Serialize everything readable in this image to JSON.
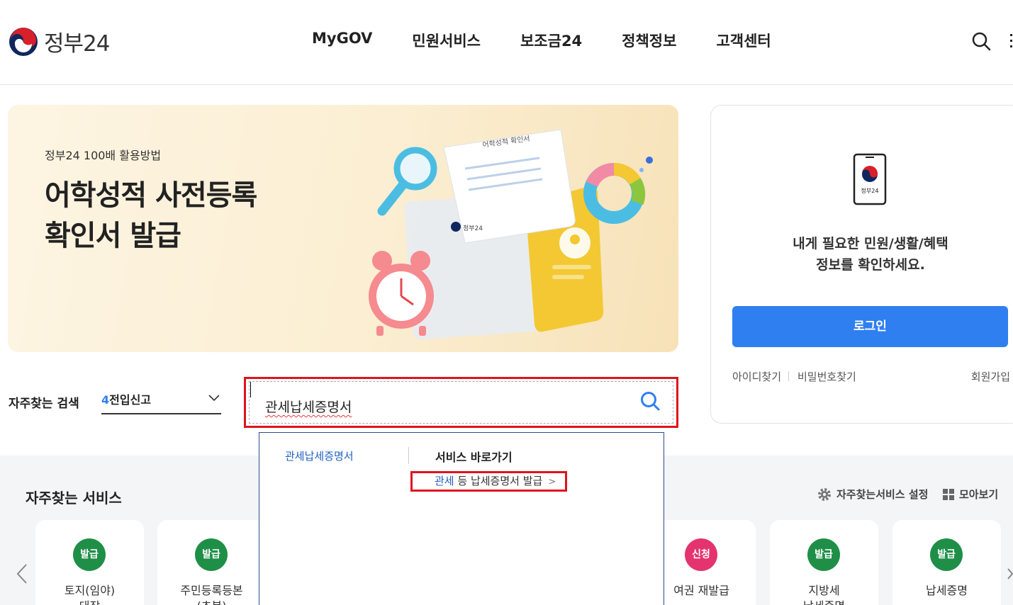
{
  "header": {
    "logo_text": "정부24",
    "nav": [
      "MyGOV",
      "민원서비스",
      "보조금24",
      "정책정보",
      "고객센터"
    ],
    "icons": [
      "search-icon",
      "menu-icon"
    ]
  },
  "banner": {
    "subtitle": "정부24 100배 활용방법",
    "title_line1": "어학성적 사전등록",
    "title_line2": "확인서 발급",
    "art_doc_title": "어학성적 확인서",
    "art_doc_brand": "정부24"
  },
  "login": {
    "phone_label": "정부24",
    "message_line1": "내게 필요한 민원/생활/혜택",
    "message_line2": "정보를 확인하세요.",
    "button": "로그인",
    "find_id": "아이디찾기",
    "find_pw": "비밀번호찾기",
    "signup": "회원가입"
  },
  "search": {
    "freq_label": "자주찾는 검색",
    "freq_rank": "4",
    "freq_term": "전입신고",
    "query": "관세납세증명서"
  },
  "autocomplete": {
    "keyword": "관세납세증명서",
    "section_title": "서비스 바로가기",
    "link_highlight": "관세",
    "link_rest": " 등 납세증명서 발급",
    "link_arrow": ">"
  },
  "services": {
    "title": "자주찾는 서비스",
    "settings": "자주찾는서비스 설정",
    "view_all": "모아보기",
    "cards": [
      {
        "badge": "발급",
        "label1": "토지(임야)",
        "label2": "대장"
      },
      {
        "badge": "발급",
        "label1": "주민등록등본",
        "label2": "(초본)"
      },
      {
        "badge": "신청",
        "label1": "여권 재발급",
        "label2": ""
      },
      {
        "badge": "발급",
        "label1": "지방세",
        "label2": "납세증명"
      },
      {
        "badge": "발급",
        "label1": "납세증명",
        "label2": ""
      }
    ]
  },
  "colors": {
    "primary_blue": "#2f7ff0",
    "highlight_red": "#e0131d",
    "badge_green": "#1f8f48",
    "badge_pink": "#e4336f"
  }
}
